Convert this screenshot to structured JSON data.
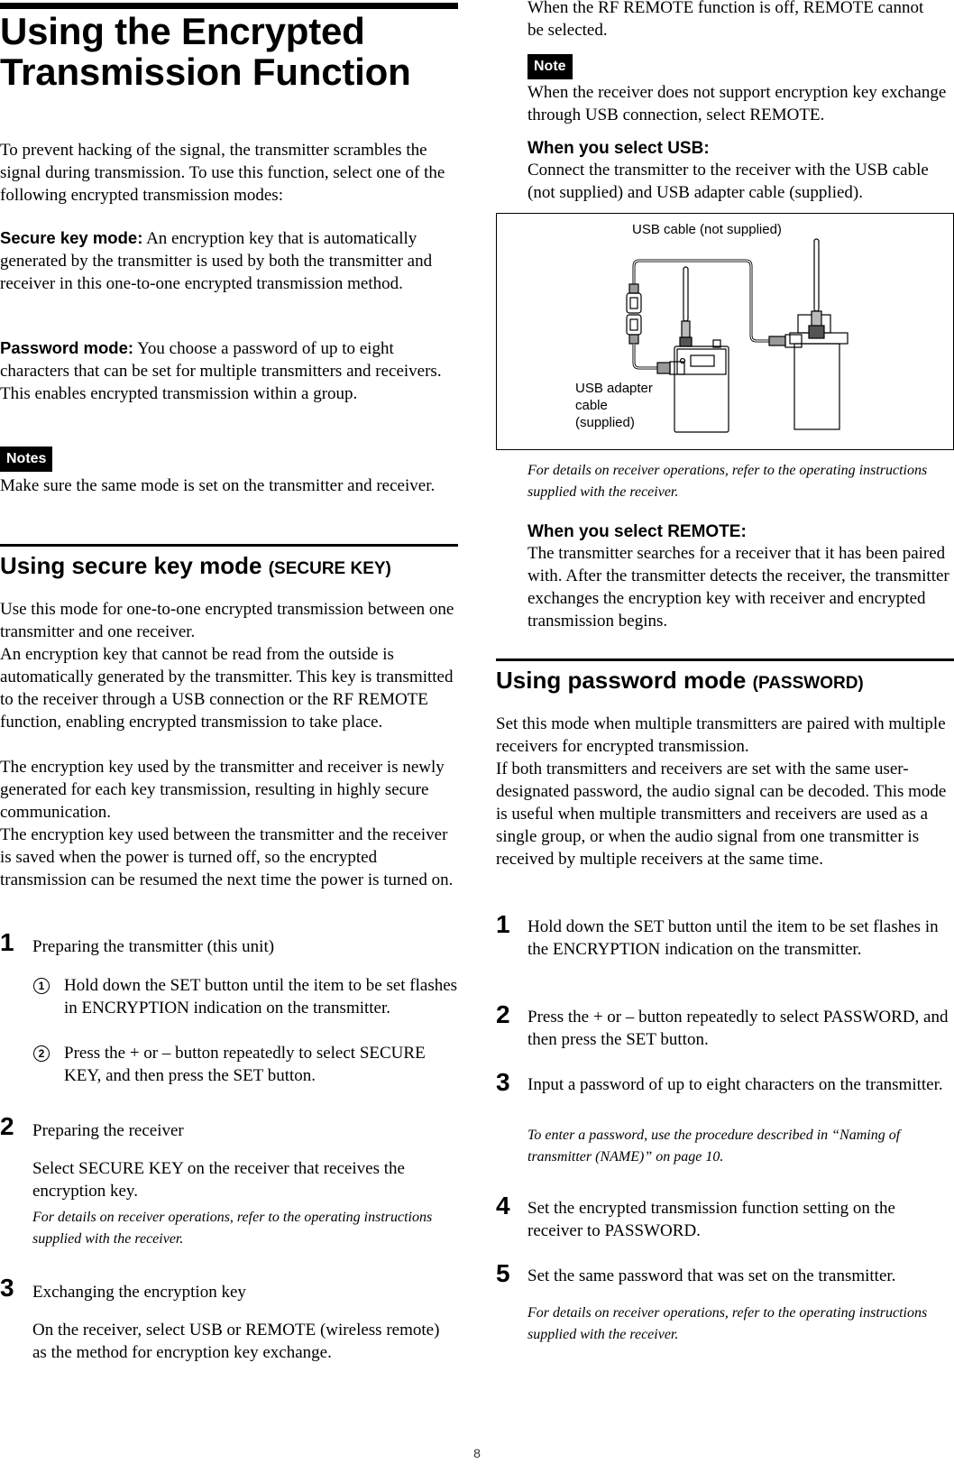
{
  "page_title": "Using the Encrypted Transmission Function",
  "intro": "To prevent hacking of the signal, the transmitter scrambles the signal during transmission. To use this function, select one of the following encrypted transmission modes:",
  "modes": [
    {
      "label": "Secure key mode:",
      "text": "An encryption key that is automatically generated by the transmitter is used by both the transmitter and receiver in this one-to-one encrypted transmission method."
    },
    {
      "label": "Password mode:",
      "text": "You choose a password of up to eight characters that can be set for multiple transmitters and receivers. This enables encrypted transmission within a group."
    }
  ],
  "notes": {
    "badge": "Notes",
    "text": "Make sure the same mode is set on the transmitter and receiver."
  },
  "secure_key_section": {
    "title": "Using secure key mode",
    "title_sub": "(SECURE KEY)",
    "paragraphs": [
      "Use this mode for one-to-one encrypted transmission between one transmitter and one receiver.",
      "An encryption key that cannot be read from the outside is automatically generated by the transmitter. This key is transmitted to the receiver through a USB connection or the RF REMOTE function, enabling encrypted transmission to take place.",
      "The encryption key used by the transmitter and receiver is newly generated for each key transmission, resulting in highly secure communication.",
      "The encryption key used between the transmitter and the receiver is saved when the power is turned off, so the encrypted transmission can be resumed the next time the power is turned on."
    ],
    "steps": [
      {
        "num": "1",
        "text": "Preparing the transmitter (this unit)",
        "substeps": [
          {
            "num": "1",
            "text": "Hold down the SET button until the item to be set flashes in ENCRYPTION indication on the transmitter."
          },
          {
            "num": "2",
            "text": "Press the + or – button repeatedly to select SECURE KEY, and then press the SET button."
          }
        ]
      },
      {
        "num": "2",
        "text": "Preparing the receiver",
        "detail": "Select SECURE KEY on the receiver that receives the encryption key.",
        "note": "For details on receiver operations, refer to the operating instructions supplied with the receiver."
      },
      {
        "num": "3",
        "text": "Exchanging the encryption key",
        "detail": "On the receiver, select USB or REMOTE (wireless remote) as the method for encryption key exchange.",
        "detail_cont": "When the RF REMOTE function is off, REMOTE cannot be selected."
      }
    ],
    "note": {
      "badge": "Note",
      "text": "When the receiver does not support encryption key exchange through USB connection, select REMOTE."
    },
    "usb": {
      "heading": "When you select USB:",
      "text": "Connect the transmitter to the receiver with the USB cable (not supplied) and USB adapter cable (supplied).",
      "figure_labels": {
        "usb_cable": "USB cable (not supplied)",
        "adapter_line1": "USB adapter",
        "adapter_line2": "cable",
        "adapter_line3": "(supplied)"
      },
      "note": "For details on receiver operations, refer to the operating instructions supplied with the receiver."
    },
    "remote": {
      "heading": "When you select REMOTE:",
      "text": "The transmitter searches for a receiver that it has been paired with. After the transmitter detects the receiver, the transmitter exchanges the encryption key with receiver and encrypted transmission begins."
    }
  },
  "password_section": {
    "title": "Using password mode",
    "title_sub": "(PASSWORD)",
    "paragraphs": [
      "Set this mode when multiple transmitters are paired with multiple receivers for encrypted transmission.",
      "If both transmitters and receivers are set with the same user-designated password, the audio signal can be decoded. This mode is useful when multiple transmitters and receivers are used as a single group, or when the audio signal from one transmitter is received by multiple receivers at the same time."
    ],
    "steps": [
      {
        "num": "1",
        "text": "Hold down the SET button until the item to be set flashes in the ENCRYPTION indication on the transmitter."
      },
      {
        "num": "2",
        "text": "Press the + or – button repeatedly to select PASSWORD, and then press the SET button."
      },
      {
        "num": "3",
        "text": "Input a password of up to eight characters on the transmitter.",
        "note": "To enter a password, use the procedure described in “Naming of transmitter (NAME)” on page 10."
      },
      {
        "num": "4",
        "text": "Set the encrypted transmission function setting on the receiver to PASSWORD."
      },
      {
        "num": "5",
        "text": "Set the same password that was set on the transmitter.",
        "note": "For details on receiver operations, refer to the operating instructions supplied with the receiver."
      }
    ]
  },
  "page_number": "8"
}
